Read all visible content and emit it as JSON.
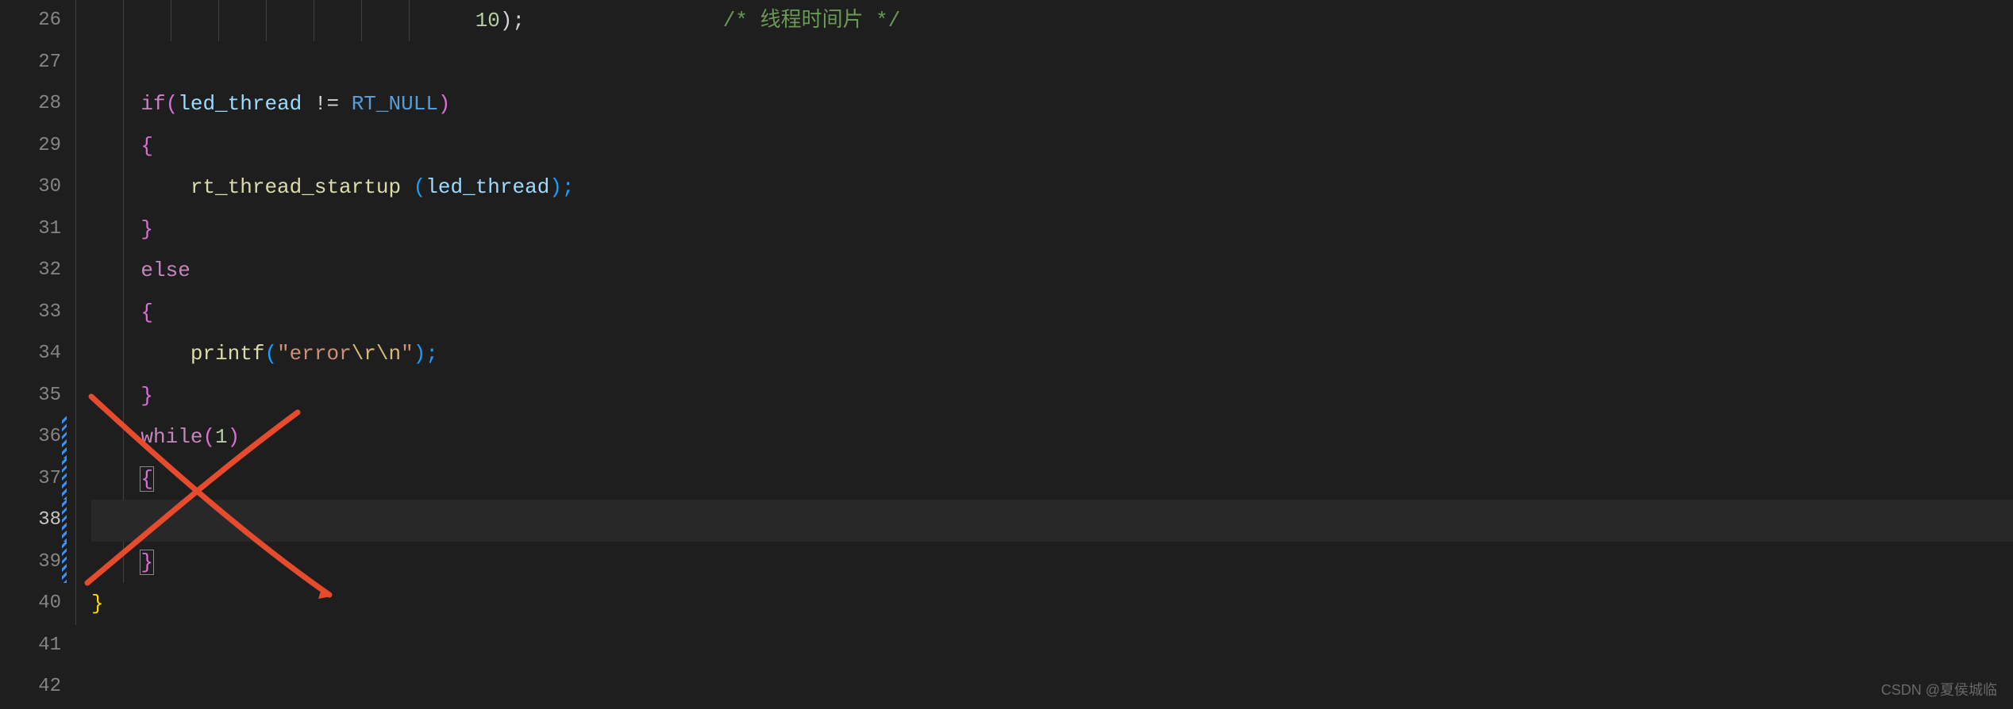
{
  "gutter": {
    "start": 26,
    "end": 42,
    "active_line": 38,
    "modified_lines": [
      36,
      37,
      38,
      39
    ]
  },
  "code": {
    "line26": {
      "num": "10",
      "punct": ");",
      "comment": "/* 线程时间片 */"
    },
    "line28": {
      "kw_if": "if",
      "p_open": "(",
      "var1": "led_thread",
      "op": " != ",
      "const": "RT_NULL",
      "p_close": ")"
    },
    "line29_brace": "{",
    "line30": {
      "func": "rt_thread_startup",
      "p_open": " (",
      "arg": "led_thread",
      "p_close": ");"
    },
    "line31_brace": "}",
    "line32_else": "else",
    "line33_brace": "{",
    "line34": {
      "func": "printf",
      "p_open": "(",
      "str_open": "\"",
      "str_body": "error",
      "esc1": "\\r",
      "esc2": "\\n",
      "str_close": "\"",
      "p_close": ");"
    },
    "line35_brace": "}",
    "line36": {
      "kw_while": "while",
      "p_open": "(",
      "num": "1",
      "p_close": ")"
    },
    "line37_brace": "{",
    "line39_brace": "}",
    "line40_brace": "}"
  },
  "watermark": "CSDN @夏侯城临"
}
